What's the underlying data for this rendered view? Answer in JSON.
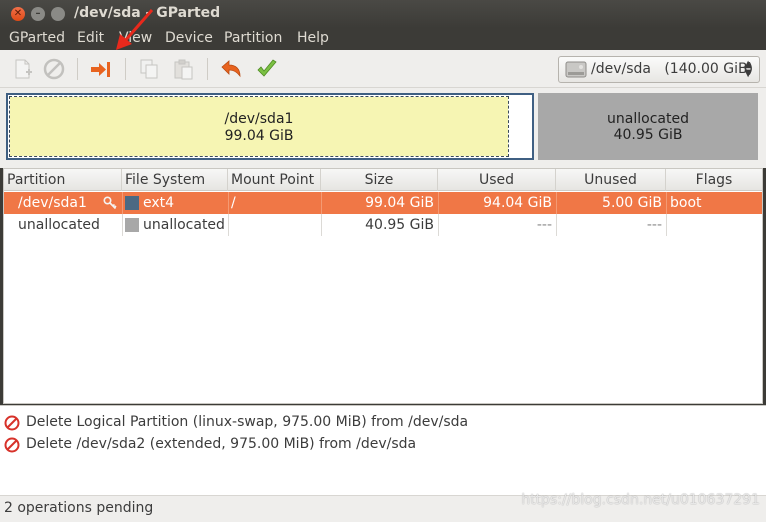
{
  "window": {
    "title": "/dev/sda - GParted"
  },
  "menubar": {
    "items": [
      "GParted",
      "Edit",
      "View",
      "Device",
      "Partition",
      "Help"
    ]
  },
  "toolbar": {
    "device_selector": "/dev/sda   (140.00 GiB)",
    "icons": [
      "new-icon",
      "delete-icon",
      "resize-move-icon",
      "copy-icon",
      "paste-icon",
      "undo-icon",
      "apply-icon"
    ]
  },
  "graph": {
    "partitions": [
      {
        "name": "/dev/sda1",
        "size": "99.04 GiB",
        "color": "#f6f5b3"
      },
      {
        "name": "unallocated",
        "size": "40.95 GiB",
        "color": "#a8a8a8"
      }
    ]
  },
  "table": {
    "headers": [
      "Partition",
      "File System",
      "Mount Point",
      "Size",
      "Used",
      "Unused",
      "Flags"
    ],
    "rows": [
      {
        "partition": "/dev/sda1",
        "fs": "ext4",
        "fs_color": "#4b6983",
        "mount": "/",
        "size": "99.04 GiB",
        "used": "94.04 GiB",
        "unused": "5.00 GiB",
        "flags": "boot",
        "selected": true
      },
      {
        "partition": "unallocated",
        "fs": "unallocated",
        "fs_color": "#a8a8a8",
        "mount": "",
        "size": "40.95 GiB",
        "used": "---",
        "unused": "---",
        "flags": "",
        "selected": false
      }
    ]
  },
  "operations": [
    "Delete Logical Partition (linux-swap, 975.00 MiB) from /dev/sda",
    "Delete /dev/sda2 (extended, 975.00 MiB) from /dev/sda"
  ],
  "status": {
    "text": "2 operations pending"
  },
  "watermark": "https://blog.csdn.net/u010637291",
  "colors": {
    "accent": "#f07746",
    "annotation_arrow": "#e8291c"
  }
}
